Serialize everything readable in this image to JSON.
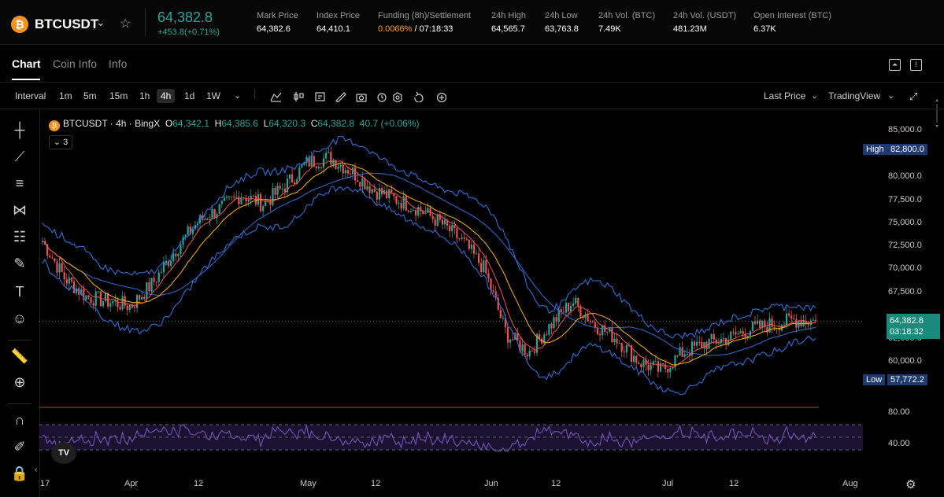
{
  "ticker": {
    "symbol": "BTCUSDT",
    "last_price": "64,382.8",
    "change": "+453.8(+0.71%)",
    "stats": [
      {
        "label": "Mark Price",
        "value": "64,382.6"
      },
      {
        "label": "Index Price",
        "value": "64,410.1"
      },
      {
        "label": "Funding (8h)/Settlement",
        "value_rate": "0.0066%",
        "value_time": " / 07:18:33"
      },
      {
        "label": "24h High",
        "value": "64,565.7"
      },
      {
        "label": "24h Low",
        "value": "63,763.8"
      },
      {
        "label": "24h Vol. (BTC)",
        "value": "7.49K"
      },
      {
        "label": "24h Vol. (USDT)",
        "value": "481.23M"
      },
      {
        "label": "Open Interest (BTC)",
        "value": "6.37K"
      }
    ]
  },
  "tabs": [
    "Chart",
    "Coin Info",
    "Info"
  ],
  "toolbar": {
    "interval_label": "Interval",
    "intervals": [
      "1m",
      "5m",
      "15m",
      "1h",
      "4h",
      "1d",
      "1W"
    ],
    "selected_interval": "4h",
    "price_source": "Last Price",
    "chart_mode": "TradingView"
  },
  "legend": {
    "title": "BTCUSDT · 4h · BingX",
    "o_label": "O",
    "o": "64,342.1",
    "h_label": "H",
    "h": "64,385.6",
    "l_label": "L",
    "l": "64,320.3",
    "c_label": "C",
    "c": "64,382.8",
    "change": "40.7 (+0.06%)",
    "indicators_count": "3"
  },
  "colors": {
    "up": "#26a69a",
    "down": "#ef5350",
    "bb": "#2f6fd6",
    "ma": "#ff9800",
    "rsi": "#7e57c2",
    "accent": "#ff9b29"
  },
  "markers": {
    "high_label": "High",
    "high_value": "82,800.0",
    "low_label": "Low",
    "low_value": "57,772.2",
    "current_price": "64,382.8",
    "countdown": "03:18:32"
  },
  "chart_data": {
    "type": "candlestick",
    "price_ticks": [
      "85,000.0",
      "82,500.0",
      "80,000.0",
      "77,500.0",
      "75,000.0",
      "72,500.0",
      "70,000.0",
      "67,500.0",
      "65,000.0",
      "62,500.0",
      "60,000.0"
    ],
    "rsi_ticks": [
      "80.00",
      "40.00"
    ],
    "x_ticks": [
      "17",
      "Apr",
      "12",
      "May",
      "12",
      "Jun",
      "12",
      "Jul",
      "12",
      "Aug"
    ],
    "ylim": [
      57000,
      86000
    ],
    "rsi_levels": [
      70,
      50,
      30
    ],
    "path_dates": [
      "Mar 17",
      "Mar 20",
      "Mar 26",
      "Apr 1",
      "Apr 5",
      "Apr 9",
      "Apr 13",
      "Apr 17",
      "Apr 20",
      "Apr 25",
      "May 1",
      "May 5",
      "May 9",
      "May 12",
      "May 16",
      "May 20",
      "May 23",
      "May 27",
      "May 30",
      "Jun 2",
      "Jun 4",
      "Jun 5",
      "Jun 8",
      "Jun 12",
      "Jun 18",
      "Jun 21",
      "Jun 24",
      "Jun 28",
      "Jul 1",
      "Jul 4",
      "Jul 8",
      "Jul 12",
      "Jul 16",
      "Jul 19",
      "Jul 23",
      "Jul 26"
    ],
    "path_close": [
      73000,
      69000,
      67000,
      66500,
      66000,
      68500,
      72000,
      75000,
      76500,
      78000,
      77000,
      79000,
      81500,
      82000,
      80500,
      78500,
      77500,
      76500,
      75000,
      73000,
      70000,
      63000,
      61000,
      64000,
      66500,
      64000,
      62500,
      60000,
      59000,
      61000,
      62000,
      62500,
      63500,
      64000,
      64500,
      64382.8
    ],
    "path_spread": [
      4000,
      5000,
      5000,
      5500,
      6000,
      6000,
      6000,
      6000,
      6000,
      6000,
      6000,
      6000,
      5000,
      5000,
      5000,
      5000,
      5000,
      5000,
      5000,
      6000,
      8000,
      9000,
      8000,
      7000,
      7000,
      7000,
      7000,
      6000,
      6000,
      6000,
      5000,
      5000,
      5000,
      5000,
      4000,
      3000
    ]
  }
}
